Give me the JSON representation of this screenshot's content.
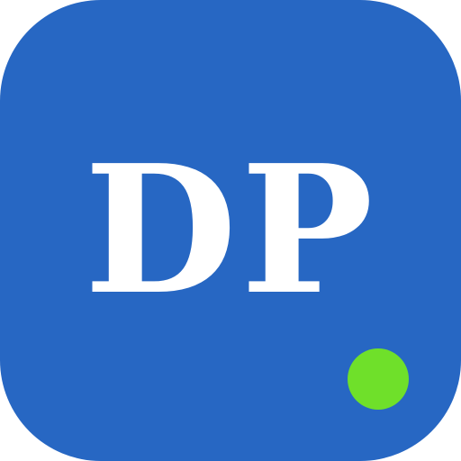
{
  "icon": {
    "initials": "DP",
    "background_color": "#2767c3",
    "text_color": "#ffffff"
  },
  "status_indicator": {
    "state": "online",
    "color": "#6fe02a"
  }
}
